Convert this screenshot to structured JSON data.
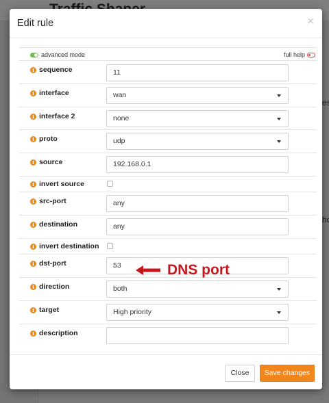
{
  "background": {
    "page_title": "Traffic Shaper",
    "fragment_1": "es",
    "fragment_2": "ho"
  },
  "modal": {
    "title": "Edit rule",
    "close_glyph": "×"
  },
  "toolbar": {
    "advanced_mode_label": "advanced mode",
    "full_help_label": "full help"
  },
  "form": {
    "sequence": {
      "label": "sequence",
      "value": "11"
    },
    "interface": {
      "label": "interface",
      "value": "wan"
    },
    "interface2": {
      "label": "interface 2",
      "value": "none"
    },
    "proto": {
      "label": "proto",
      "value": "udp"
    },
    "source": {
      "label": "source",
      "value": "192.168.0.1"
    },
    "invert_source": {
      "label": "invert source",
      "checked": false
    },
    "src_port": {
      "label": "src-port",
      "value": "any"
    },
    "destination": {
      "label": "destination",
      "value": "any"
    },
    "invert_destination": {
      "label": "invert destination",
      "checked": false
    },
    "dst_port": {
      "label": "dst-port",
      "value": "53"
    },
    "direction": {
      "label": "direction",
      "value": "both"
    },
    "target": {
      "label": "target",
      "value": "High priority"
    },
    "description": {
      "label": "description",
      "value": ""
    }
  },
  "annotation": {
    "text": "DNS port"
  },
  "footer": {
    "close_label": "Close",
    "save_label": "Save changes"
  },
  "colors": {
    "info_icon": "#e98a1d",
    "save_button": "#f1861d",
    "annotation": "#c4171d",
    "toggle_on": "#6cc04a",
    "toggle_off": "#e0454b"
  },
  "icons": {
    "info": "info-icon",
    "close": "close-icon",
    "dropdown": "chevron-down-icon",
    "annotation_arrow": "arrow-left-icon"
  }
}
